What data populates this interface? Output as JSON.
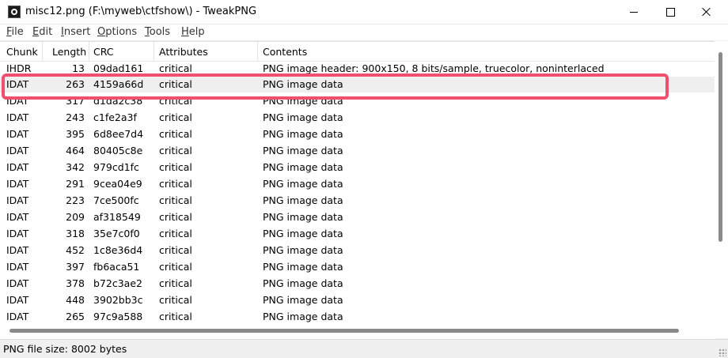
{
  "window": {
    "title": "misc12.png (F:\\myweb\\ctfshow\\) - TweakPNG"
  },
  "menu": [
    {
      "mnemonic": "F",
      "rest": "ile"
    },
    {
      "mnemonic": "E",
      "rest": "dit"
    },
    {
      "mnemonic": "I",
      "rest": "nsert"
    },
    {
      "mnemonic": "O",
      "rest": "ptions"
    },
    {
      "mnemonic": "T",
      "rest": "ools"
    },
    {
      "mnemonic": "H",
      "rest": "elp"
    }
  ],
  "table": {
    "columns": [
      "Chunk",
      "Length",
      "CRC",
      "Attributes",
      "Contents"
    ],
    "rows": [
      {
        "chunk": "IHDR",
        "length": "13",
        "crc": "09dad161",
        "attr": "critical",
        "contents": "PNG image header: 900x150, 8 bits/sample, truecolor, noninterlaced"
      },
      {
        "chunk": "IDAT",
        "length": "263",
        "crc": "4159a66d",
        "attr": "critical",
        "contents": "PNG image data"
      },
      {
        "chunk": "IDAT",
        "length": "317",
        "crc": "d1da2c38",
        "attr": "critical",
        "contents": "PNG image data"
      },
      {
        "chunk": "IDAT",
        "length": "243",
        "crc": "c1fe2a3f",
        "attr": "critical",
        "contents": "PNG image data"
      },
      {
        "chunk": "IDAT",
        "length": "395",
        "crc": "6d8ee7d4",
        "attr": "critical",
        "contents": "PNG image data"
      },
      {
        "chunk": "IDAT",
        "length": "464",
        "crc": "80405c8e",
        "attr": "critical",
        "contents": "PNG image data"
      },
      {
        "chunk": "IDAT",
        "length": "342",
        "crc": "979cd1fc",
        "attr": "critical",
        "contents": "PNG image data"
      },
      {
        "chunk": "IDAT",
        "length": "291",
        "crc": "9cea04e9",
        "attr": "critical",
        "contents": "PNG image data"
      },
      {
        "chunk": "IDAT",
        "length": "223",
        "crc": "7ce500fc",
        "attr": "critical",
        "contents": "PNG image data"
      },
      {
        "chunk": "IDAT",
        "length": "209",
        "crc": "af318549",
        "attr": "critical",
        "contents": "PNG image data"
      },
      {
        "chunk": "IDAT",
        "length": "318",
        "crc": "35e7c0f0",
        "attr": "critical",
        "contents": "PNG image data"
      },
      {
        "chunk": "IDAT",
        "length": "452",
        "crc": "1c8e36d4",
        "attr": "critical",
        "contents": "PNG image data"
      },
      {
        "chunk": "IDAT",
        "length": "397",
        "crc": "fb6aca51",
        "attr": "critical",
        "contents": "PNG image data"
      },
      {
        "chunk": "IDAT",
        "length": "378",
        "crc": "b72c3ae2",
        "attr": "critical",
        "contents": "PNG image data"
      },
      {
        "chunk": "IDAT",
        "length": "448",
        "crc": "3902bb3c",
        "attr": "critical",
        "contents": "PNG image data"
      },
      {
        "chunk": "IDAT",
        "length": "265",
        "crc": "97c9a588",
        "attr": "critical",
        "contents": "PNG image data"
      }
    ]
  },
  "status": {
    "text": "PNG file size: 8002 bytes"
  },
  "colors": {
    "highlight": "#f0506e",
    "selected_row": "#efefef"
  },
  "icons": [
    "app-icon",
    "minimize-icon",
    "maximize-icon",
    "close-icon"
  ]
}
